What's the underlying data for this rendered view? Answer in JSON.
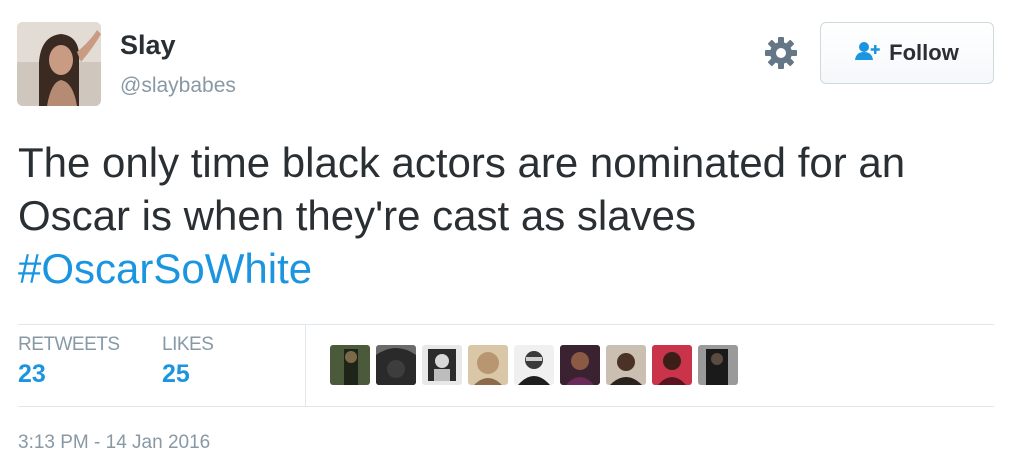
{
  "user": {
    "name": "Slay",
    "handle": "@slaybabes"
  },
  "follow_button": {
    "label": "Follow",
    "icon": "add-person-icon"
  },
  "settings_icon": "gear-icon",
  "tweet": {
    "text": "The only time black actors are nominated for an Oscar is when they're cast as slaves",
    "hashtag": "#OscarSoWhite"
  },
  "stats": {
    "retweets_label": "RETWEETS",
    "retweets_value": "23",
    "likes_label": "LIKES",
    "likes_value": "25"
  },
  "timestamp": "3:13 PM - 14 Jan 2016",
  "colors": {
    "link": "#1b95e0",
    "muted": "#8899a6",
    "text": "#292f33"
  }
}
